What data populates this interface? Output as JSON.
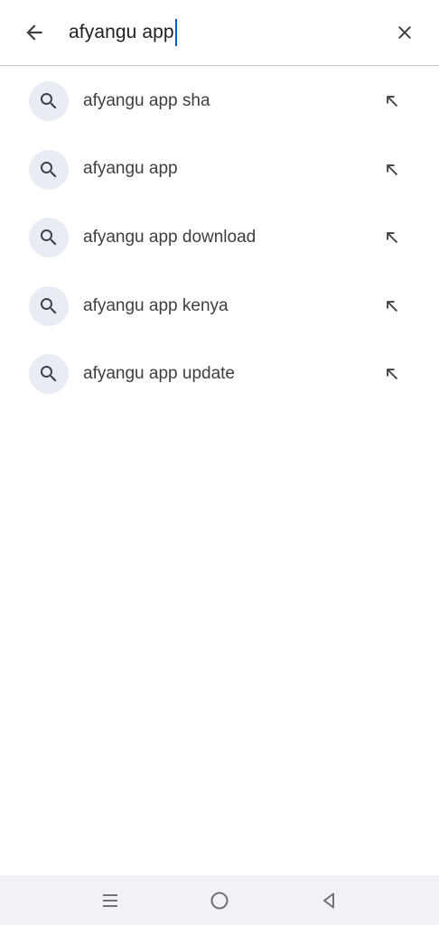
{
  "search": {
    "query": "afyangu app"
  },
  "suggestions": [
    {
      "label": "afyangu app sha",
      "icon": "search-icon",
      "action_icon": "arrow-up-left-icon"
    },
    {
      "label": "afyangu app",
      "icon": "search-icon",
      "action_icon": "arrow-up-left-icon"
    },
    {
      "label": "afyangu app download",
      "icon": "search-icon",
      "action_icon": "arrow-up-left-icon"
    },
    {
      "label": "afyangu app kenya",
      "icon": "search-icon",
      "action_icon": "arrow-up-left-icon"
    },
    {
      "label": "afyangu app update",
      "icon": "search-icon",
      "action_icon": "arrow-up-left-icon"
    }
  ],
  "icons": {
    "back": "arrow-back-icon",
    "clear": "close-icon",
    "nav_recents": "menu-icon",
    "nav_home": "circle-home-icon",
    "nav_back": "triangle-back-icon"
  },
  "colors": {
    "caret": "#0b57d0",
    "icon_circle": "#e8ecf3",
    "nav_bar": "#f1f2f6",
    "divider": "#c4c7c5"
  }
}
